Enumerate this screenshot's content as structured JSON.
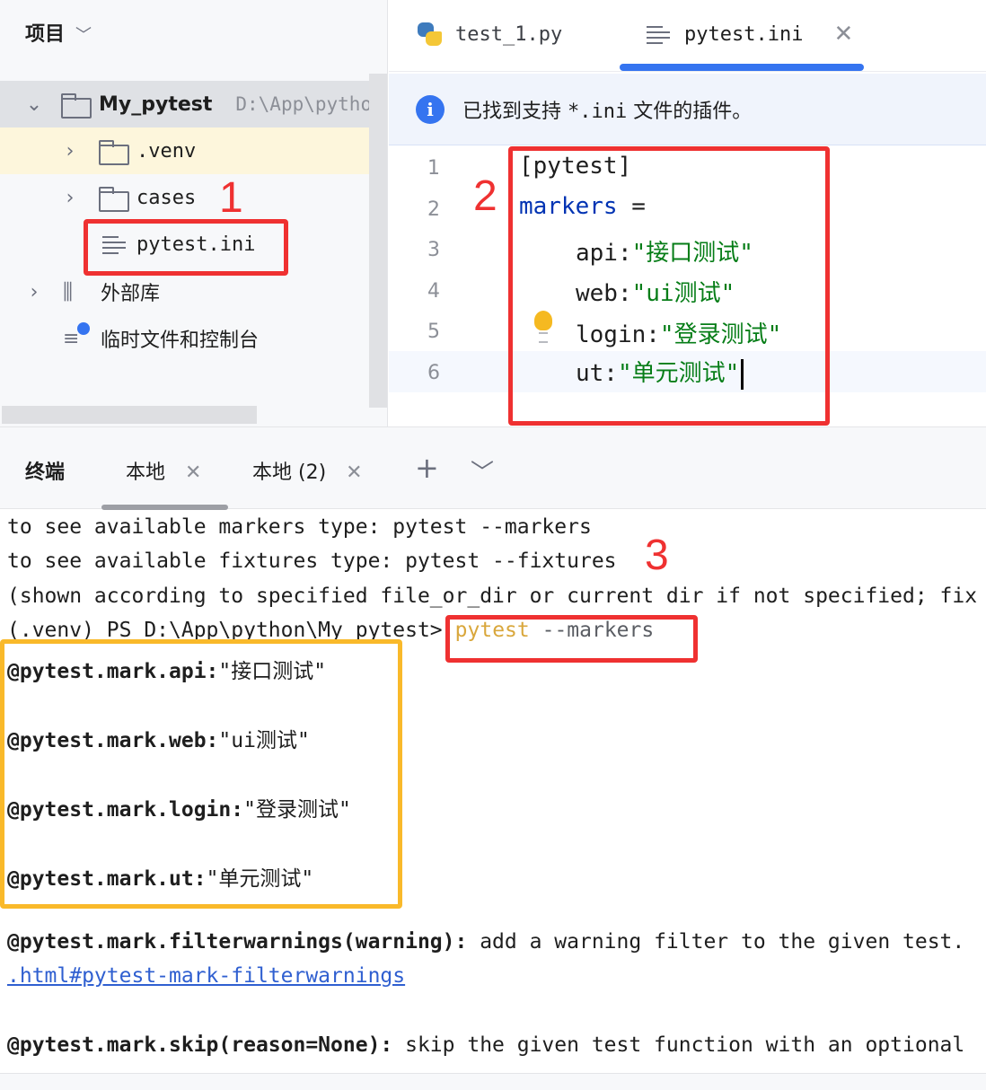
{
  "project_panel": {
    "title": "项目",
    "root": {
      "name": "My_pytest",
      "path": "D:\\App\\python\\"
    },
    "items": [
      {
        "label": ".venv",
        "type": "folder"
      },
      {
        "label": "cases",
        "type": "folder"
      },
      {
        "label": "pytest.ini",
        "type": "file"
      },
      {
        "label": "外部库",
        "type": "library"
      },
      {
        "label": "临时文件和控制台",
        "type": "scratch"
      }
    ]
  },
  "editor": {
    "tabs": [
      {
        "label": "test_1.py",
        "icon": "python-icon",
        "active": false
      },
      {
        "label": "pytest.ini",
        "icon": "ini-file-icon",
        "active": true
      }
    ],
    "notification": {
      "prefix": "已找到支持 ",
      "extension": "*.ini",
      "suffix": " 文件的插件。"
    },
    "line_numbers": [
      "1",
      "2",
      "3",
      "4",
      "5",
      "6"
    ],
    "lines": {
      "l1": "[pytest]",
      "l2_key": "markers",
      "l2_eq": " =",
      "l3_key": "api:",
      "l3_val": "\"接口测试\"",
      "l4_key": "web:",
      "l4_val": "\"ui测试\"",
      "l5_key": "login:",
      "l5_val": "\"登录测试\"",
      "l6_key": "ut:",
      "l6_val": "\"单元测试\""
    }
  },
  "terminal": {
    "title": "终端",
    "tabs": [
      "本地",
      "本地 (2)"
    ],
    "lines": {
      "l1": "to see available markers type: pytest --markers",
      "l2": "to see available fixtures type: pytest --fixtures",
      "l3": "(shown according to specified file_or_dir or current dir if not specified; fix",
      "prompt": "(.venv) PS D:\\App\\python\\My_pytest>",
      "cmd_main": "pytest",
      "cmd_arg": " --markers",
      "m1_name": "@pytest.mark.api:",
      "m1_desc": "\"接口测试\"",
      "m2_name": "@pytest.mark.web:",
      "m2_desc": "\"ui测试\"",
      "m3_name": "@pytest.mark.login:",
      "m3_desc": "\"登录测试\"",
      "m4_name": "@pytest.mark.ut:",
      "m4_desc": "\"单元测试\"",
      "fw_name": "@pytest.mark.filterwarnings(warning):",
      "fw_desc": " add a warning filter to the given test.",
      "fw_link": ".html#pytest-mark-filterwarnings",
      "skip_name": "@pytest.mark.skip(reason=None):",
      "skip_desc": " skip the given test function with an optional"
    }
  },
  "annotations": [
    "1",
    "2",
    "3"
  ],
  "colors": {
    "annotation_red": "#ef3131",
    "annotation_orange": "#f9b92a",
    "tab_accent": "#3574f0",
    "keyword": "#0033b3",
    "string": "#067d17"
  }
}
